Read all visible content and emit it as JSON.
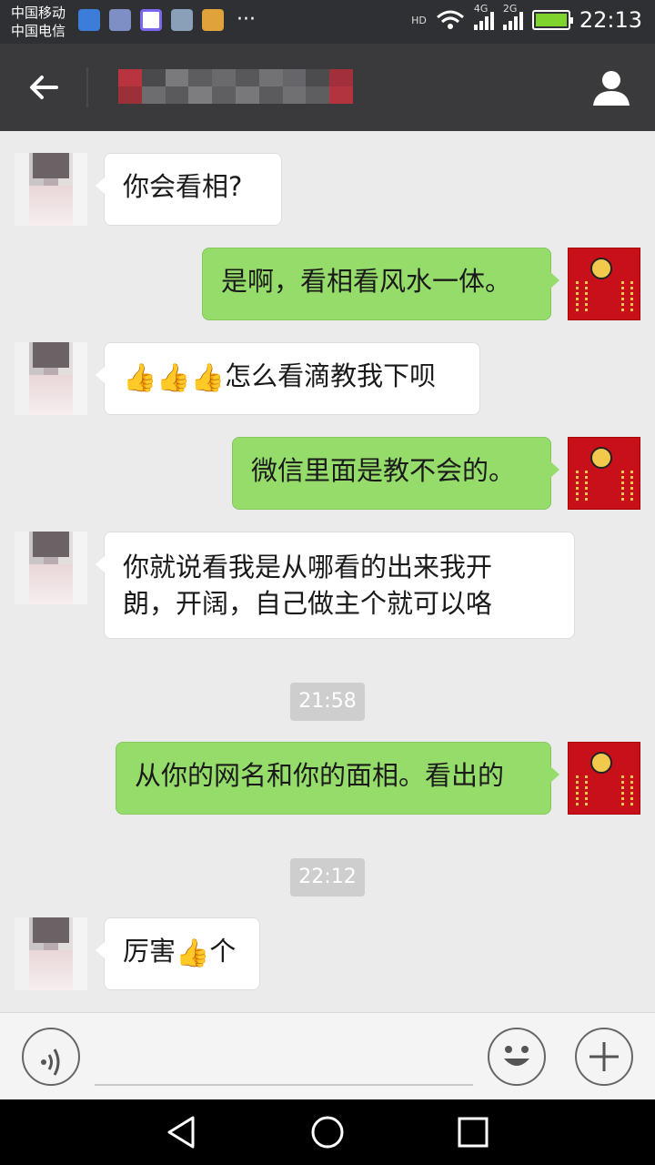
{
  "status_bar": {
    "carrier_1": "中国移动",
    "carrier_2": "中国电信",
    "more": "···",
    "hd": "HD",
    "net_1": "4G",
    "net_2": "2G",
    "time": "22:13"
  },
  "header": {
    "back_icon": "arrow-left-icon",
    "profile_icon": "person-icon"
  },
  "messages": [
    {
      "side": "in",
      "text": "你会看相?"
    },
    {
      "side": "out",
      "text": "是啊，看相看风水一体。"
    },
    {
      "side": "in",
      "emoji": "👍👍👍",
      "text": "怎么看滴教我下呗"
    },
    {
      "side": "out",
      "text": "微信里面是教不会的。"
    },
    {
      "side": "in",
      "text_line1": "你就说看我是从哪看的出来我开",
      "text_line2": "朗，开阔，自己做主个就可以咯"
    },
    {
      "side": "time",
      "text": "21:58"
    },
    {
      "side": "out",
      "text": "从你的网名和你的面相。看出的"
    },
    {
      "side": "time",
      "text": "22:12"
    },
    {
      "side": "in",
      "text_before": "厉害",
      "emoji": "👍",
      "text_after": "个"
    }
  ],
  "input_bar": {
    "voice_icon": "voice-icon",
    "emoji_icon": "smiley-icon",
    "plus_icon": "plus-icon",
    "placeholder": ""
  },
  "nav_bar": {
    "back": "triangle-back-icon",
    "home": "circle-home-icon",
    "recents": "square-recents-icon"
  },
  "colors": {
    "outgoing_bubble": "#95dc6b",
    "incoming_bubble": "#ffffff",
    "header_bg": "#3a3a3c",
    "chat_bg": "#ebebeb"
  }
}
